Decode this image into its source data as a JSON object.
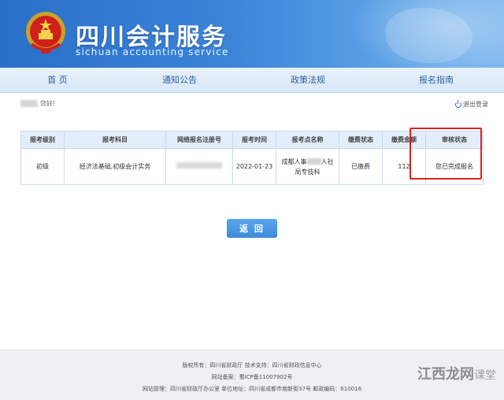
{
  "header": {
    "title": "四川会计服务",
    "subtitle": "sichuan accounting service"
  },
  "nav": {
    "items": [
      {
        "label": "首 页"
      },
      {
        "label": "通知公告"
      },
      {
        "label": "政策法规"
      },
      {
        "label": "报名指南"
      }
    ]
  },
  "user": {
    "greeting": "您好!",
    "logout_label": "退出登录"
  },
  "table": {
    "headers": [
      "报考级别",
      "报考科目",
      "网络报名注册号",
      "报考时间",
      "报考点名称",
      "缴费状态",
      "缴费金额",
      "审核状态"
    ],
    "row": {
      "level": "初级",
      "subjects": "经济法基础,初级会计实务",
      "register_no": "",
      "date": "2022-01-23",
      "site_part1": "成都人事",
      "site_part2": "人社",
      "site_part3": "局专技科",
      "pay_status": "已缴费",
      "amount": "112",
      "review_status": "您已完成报名"
    }
  },
  "back_button": {
    "label": "返 回"
  },
  "footer": {
    "line1": "版权所有：四川省财政厅 技术支持：四川省财政信息中心",
    "line2": "网站备案：蜀ICP备11007902号",
    "line3": "网站管理：四川省财政厅办公室 单位地址：四川省成都市南新街37号 邮政编码：610016"
  },
  "watermark": {
    "text": "江西龙网",
    "suffix": "课堂"
  },
  "colors": {
    "banner": "#3b84d8",
    "nav_text": "#2d5f9e",
    "highlight": "#e02020",
    "button": "#4a96e2"
  }
}
